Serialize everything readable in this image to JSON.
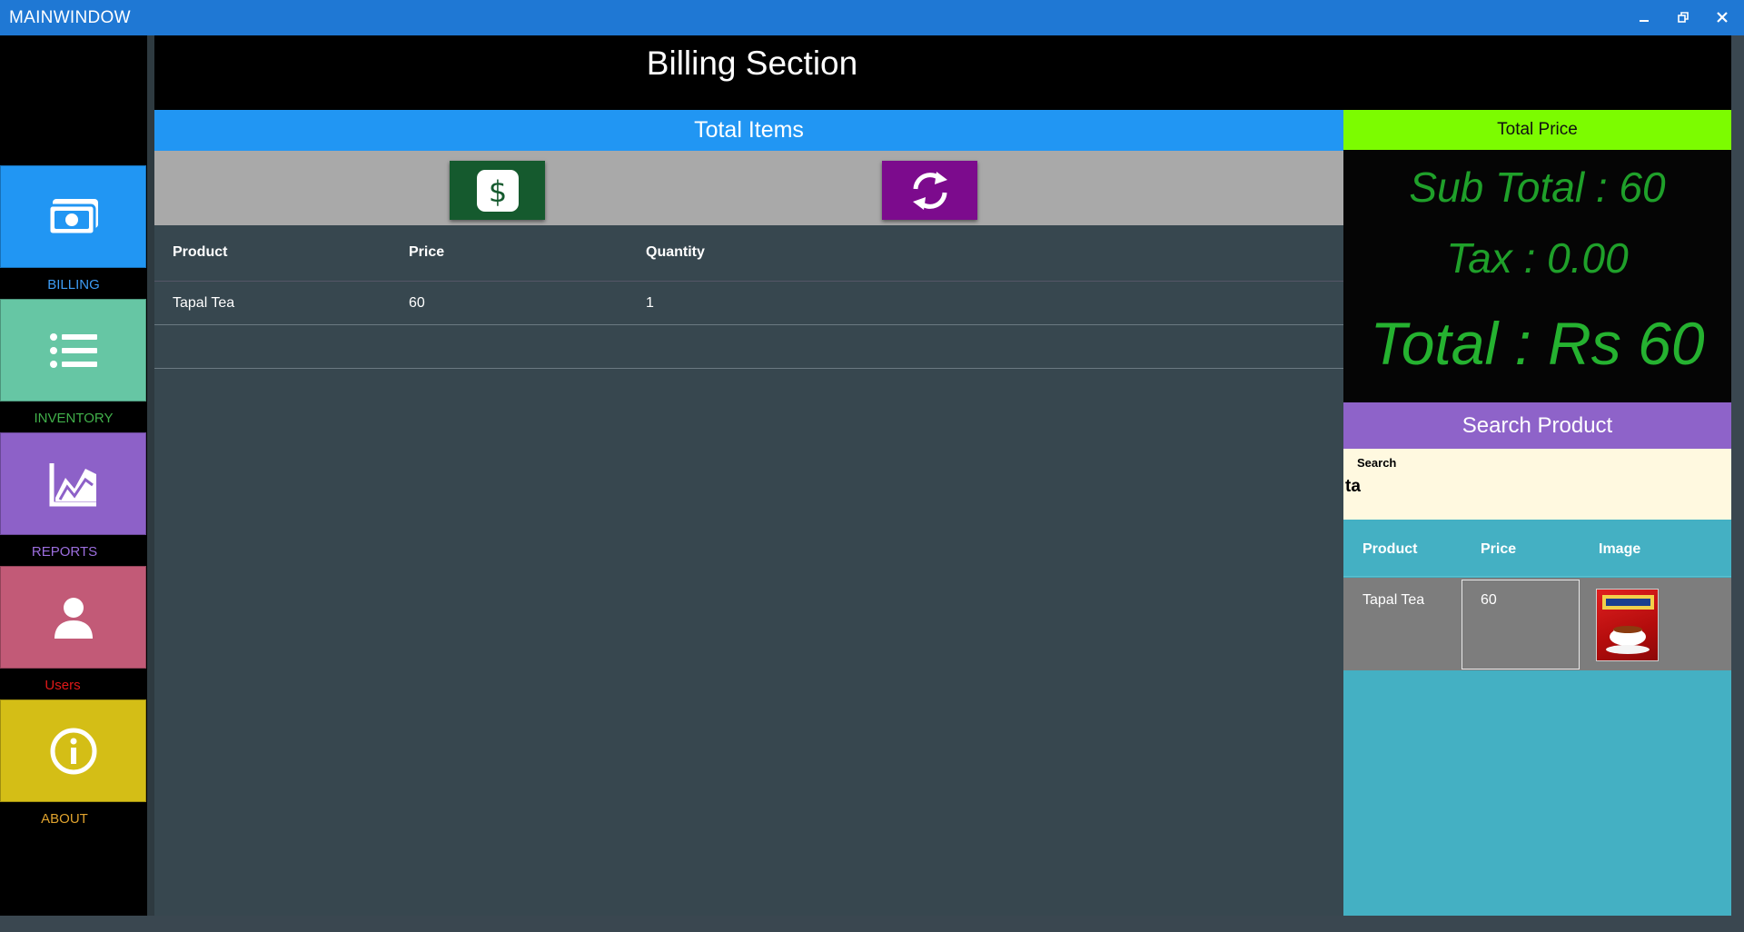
{
  "window": {
    "title": "MAINWINDOW",
    "buttons": {
      "minimize": "minimize-icon",
      "restore": "restore-icon",
      "close": "close-icon"
    }
  },
  "sidebar": {
    "items": [
      {
        "label": "BILLING",
        "icon": "money-icon",
        "tile_color": "#2196f3",
        "label_color": "#3d9cf5"
      },
      {
        "label": "INVENTORY",
        "icon": "list-icon",
        "tile_color": "#66c6a4",
        "label_color": "#41b04a"
      },
      {
        "label": "REPORTS",
        "icon": "chart-line-icon",
        "tile_color": "#8d61c8",
        "label_color": "#9c6ede"
      },
      {
        "label": "Users",
        "icon": "user-icon",
        "tile_color": "#c25a77",
        "label_color": "#e01818"
      },
      {
        "label": "ABOUT",
        "icon": "info-icon",
        "tile_color": "#d4be16",
        "label_color": "#e0a32e"
      }
    ]
  },
  "header": {
    "title": "Billing Section"
  },
  "items": {
    "header": "Total Items",
    "toolbar": {
      "pay_icon": "dollar-icon",
      "pay_color": "#155a2e",
      "refresh_icon": "refresh-icon",
      "refresh_color": "#7c0b8d"
    },
    "columns": [
      "Product",
      "Price",
      "Quantity"
    ],
    "rows": [
      [
        "Tapal Tea",
        "60",
        "1"
      ],
      [
        "",
        "",
        ""
      ]
    ]
  },
  "price": {
    "header": "Total Price",
    "subtotal": "Sub Total : 60",
    "tax": "Tax :  0.00",
    "total": "Total : Rs 60"
  },
  "search": {
    "header": "Search Product",
    "label": "Search",
    "value": "ta",
    "columns": [
      "Product",
      "Price",
      "Image"
    ],
    "results": [
      {
        "product": "Tapal Tea",
        "price": "60",
        "image": "tapal-tea-pack-image"
      }
    ]
  }
}
